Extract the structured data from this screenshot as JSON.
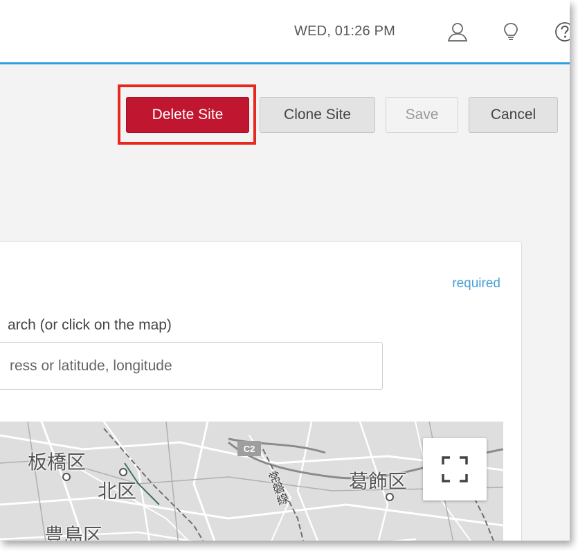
{
  "header": {
    "datetime": "WED, 01:26 PM",
    "icons": [
      "user-icon",
      "lightbulb-icon",
      "help-icon"
    ],
    "accent_color": "#2d9fe0"
  },
  "actions": {
    "delete_label": "Delete Site",
    "clone_label": "Clone Site",
    "save_label": "Save",
    "cancel_label": "Cancel",
    "delete_color": "#c1162f",
    "highlight_color": "#e8281e"
  },
  "location": {
    "required_label": "required",
    "search_label": "arch (or click on the map)",
    "search_placeholder": "ress or latitude, longitude",
    "search_value": ""
  },
  "map": {
    "labels": {
      "itabashi": "板橋区",
      "kita": "北区",
      "toshima": "豊島区",
      "katsushika": "葛飾区",
      "joban_line": "常磐線",
      "c2": "C2"
    },
    "fullscreen_icon": "fullscreen-icon"
  }
}
